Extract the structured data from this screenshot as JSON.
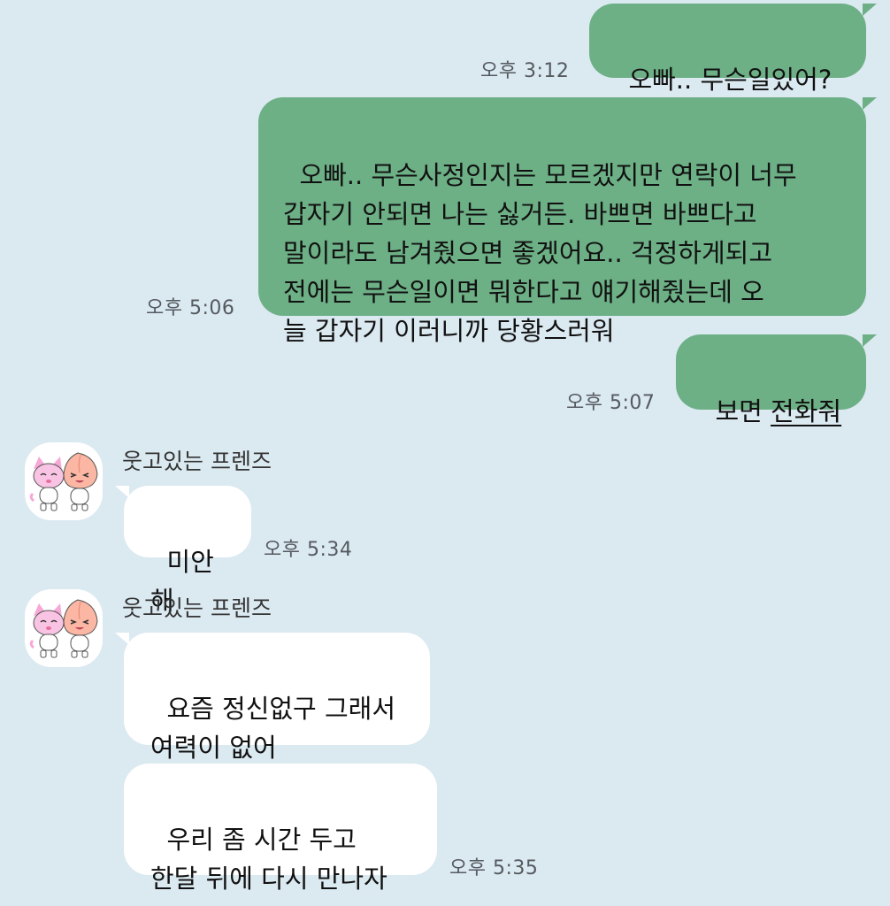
{
  "colors": {
    "background": "#dbe9f1",
    "sent_bubble": "#6db086",
    "received_bubble": "#ffffff",
    "timestamp": "#555a5f"
  },
  "messages": {
    "m1": {
      "text": "오빠.. 무슨일있어?",
      "time": "오후 3:12"
    },
    "m2": {
      "text": "오빠.. 무슨사정인지는 모르겠지만 연락이 너무\n갑자기 안되면 나는 싫거든. 바쁘면 바쁘다고\n말이라도 남겨줬으면 좋겠어요.. 걱정하게되고\n전에는 무슨일이면 뭐한다고 얘기해줬는데 오\n늘 갑자기 이러니까 당황스러워",
      "time": "오후 5:06"
    },
    "m3": {
      "text_plain": "보면 ",
      "text_link": "전화줘",
      "time": "오후 5:07"
    },
    "r1": {
      "sender": "웃고있는 프렌즈",
      "text": "미안해",
      "time": "오후 5:34",
      "avatar_icon": "friends-sticker-icon"
    },
    "r2": {
      "sender": "웃고있는 프렌즈",
      "text": "요즘 정신없구 그래서\n여력이 없어",
      "text2": "우리 좀 시간 두고\n한달 뒤에 다시 만나자",
      "time": "오후 5:35",
      "avatar_icon": "friends-sticker-icon"
    }
  }
}
